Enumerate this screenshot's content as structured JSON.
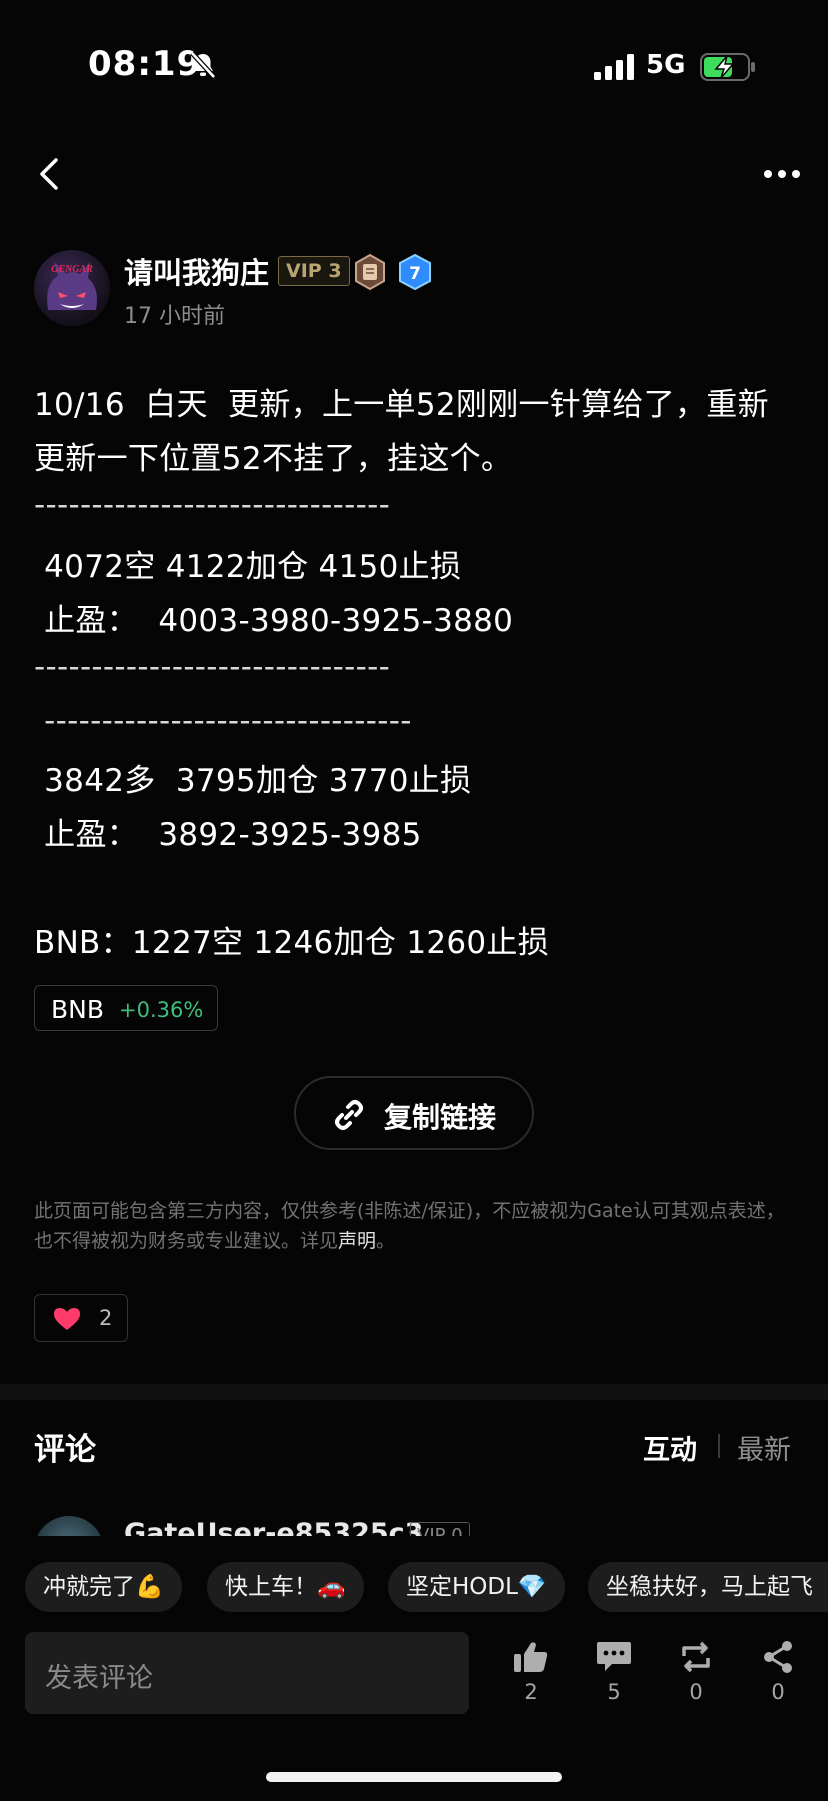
{
  "status_bar": {
    "time": "08:19",
    "network": "5G"
  },
  "post": {
    "author": "请叫我狗庄",
    "vip": "VIP 3",
    "badge_level": "7",
    "time_ago": "17 小时前",
    "avatar_text": "GENGAR",
    "lines": [
      "10/16  白天  更新，上一单52刚刚一针算给了，重新",
      "更新一下位置52不挂了，挂这个。",
      "-------------------------------",
      " 4072空 4122加仓 4150止损",
      " 止盈：  4003-3980-3925-3880",
      "-------------------------------",
      " --------------------------------",
      " 3842多  3795加仓 3770止损",
      " 止盈：  3892-3925-3985",
      "BNB：1227空 1246加仓 1260止损"
    ],
    "token": {
      "symbol": "BNB",
      "change": "+0.36%"
    },
    "copy_link_label": "复制链接",
    "disclaimer_text": "此页面可能包含第三方内容，仅供参考(非陈述/保证)，不应被视为Gate认可其观点表述，也不得被视为财务或专业建议。详见",
    "disclaimer_link": "声明",
    "disclaimer_end": "。",
    "likes": "2"
  },
  "comments": {
    "title": "评论",
    "tabs": [
      "互动",
      "最新"
    ],
    "first_user": "GateUser-e85325c3",
    "first_user_vip": "VIP 0"
  },
  "quick_replies": [
    "冲就完了💪",
    "快上车！🚗",
    "坚定HODL💎",
    "坐稳扶好，马上起飞"
  ],
  "composer": {
    "placeholder": "发表评论"
  },
  "actions": [
    {
      "name": "like",
      "icon": "thumbs-up-icon",
      "count": "2"
    },
    {
      "name": "comment",
      "icon": "comment-icon",
      "count": "5"
    },
    {
      "name": "repost",
      "icon": "repost-icon",
      "count": "0"
    },
    {
      "name": "share",
      "icon": "share-icon",
      "count": "0"
    }
  ],
  "colors": {
    "background": "#050505",
    "positive": "#3fbf7a",
    "heart": "#ff3b6b",
    "battery": "#3ddc5c"
  }
}
